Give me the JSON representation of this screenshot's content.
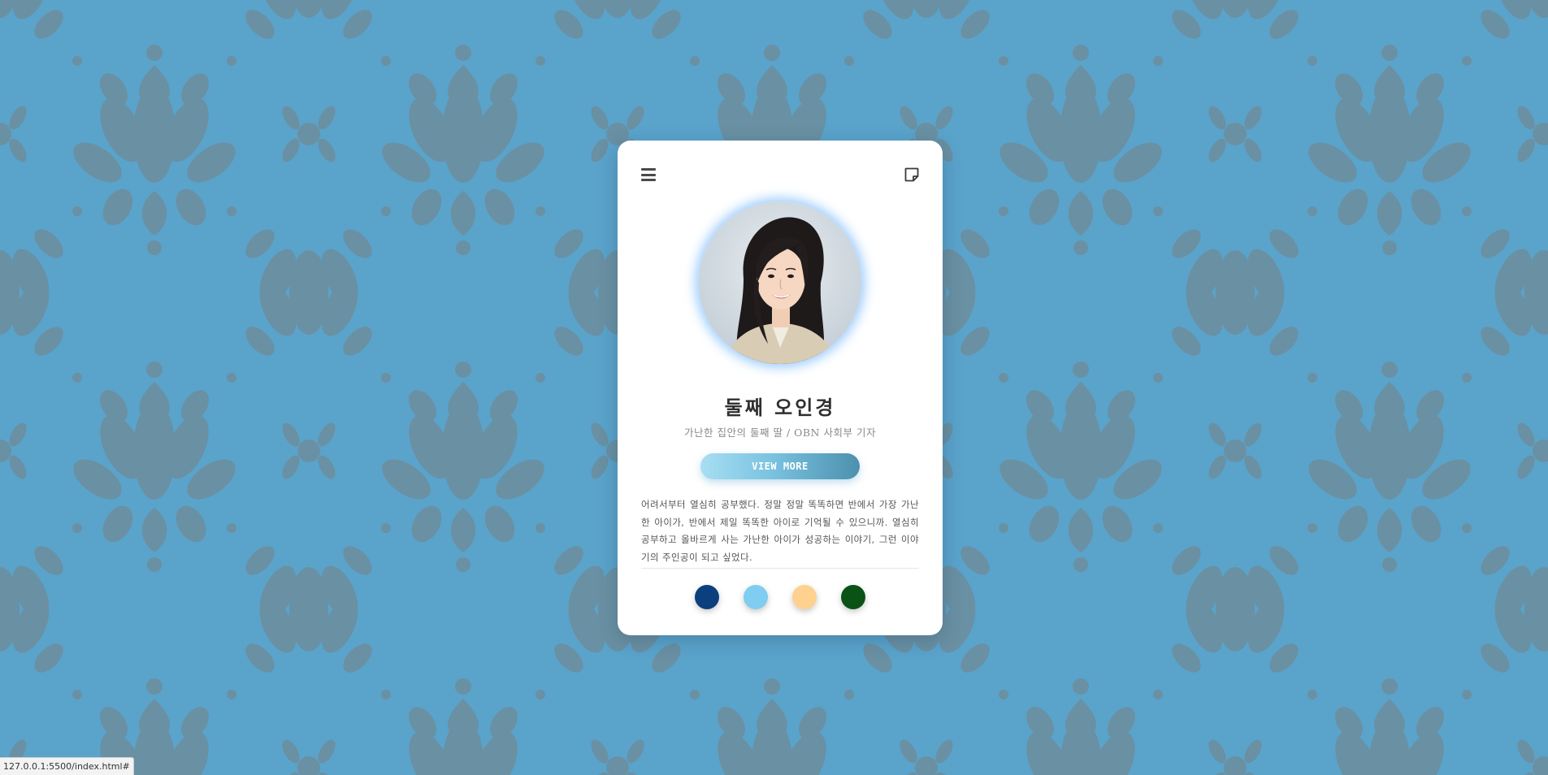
{
  "page": {
    "background_color": "#5aa3cb",
    "pattern_color": "#6a8fa1",
    "pattern_name": "damask-pattern"
  },
  "card": {
    "menu_icon": "hamburger-menu-icon",
    "note_icon": "sticky-note-icon",
    "name": "둘째 오인경",
    "subtitle": "가난한 집안의 둘째 딸 / OBN 사회부 기자",
    "button_label": "VIEW MORE",
    "description": "어려서부터 열심히 공부했다. 정말 정말 똑똑하면 반에서 가장 가난한 아이가, 반에서 제일 똑똑한 아이로 기억될 수 있으니까. 열심히 공부하고 올바르게 사는 가난한 아이가 성공하는 이야기, 그런 이야기의 주인공이 되고 싶었다.",
    "swatches": [
      {
        "name": "navy",
        "color": "#0c3f7d"
      },
      {
        "name": "sky-blue",
        "color": "#7fcdf0"
      },
      {
        "name": "peach",
        "color": "#ffd18f"
      },
      {
        "name": "dark-green",
        "color": "#0a5216"
      }
    ]
  },
  "status_bar": {
    "url": "127.0.0.1:5500/index.html#"
  }
}
